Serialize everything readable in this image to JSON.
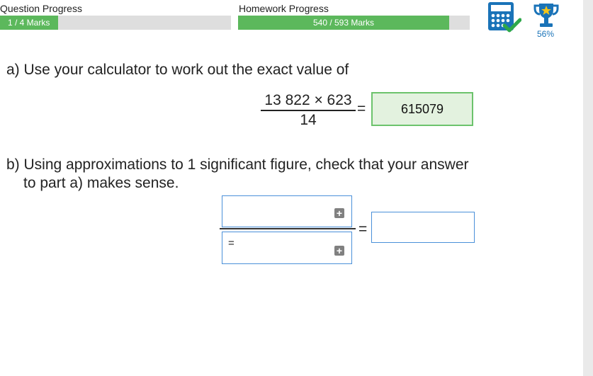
{
  "header": {
    "question_progress": {
      "label": "Question Progress",
      "text": "1 / 4 Marks",
      "fraction": 0.25
    },
    "homework_progress": {
      "label": "Homework Progress",
      "text": "540 / 593 Marks",
      "fraction": 0.9106
    },
    "calculator_icon": "calculator-allowed-icon",
    "trophy_icon": "trophy-icon",
    "trophy_percent": "56%"
  },
  "part_a": {
    "prompt": "a) Use your calculator to work out the exact value of",
    "numerator": "13 822 × 623",
    "denominator": "14",
    "equals": "=",
    "answer": "615079"
  },
  "part_b": {
    "prompt_line1": "b) Using approximations to 1 significant figure, check that your answer",
    "prompt_line2": "to part a) makes sense.",
    "denominator_prefix": "=",
    "equals": "=",
    "plus_symbol": "+"
  },
  "colors": {
    "progress_fill": "#5cb85c",
    "progress_track": "#dedede",
    "correct_bg": "#e3f2df",
    "correct_border": "#6cc36c",
    "input_border": "#4a90d9",
    "icon_blue": "#1a73b8"
  }
}
